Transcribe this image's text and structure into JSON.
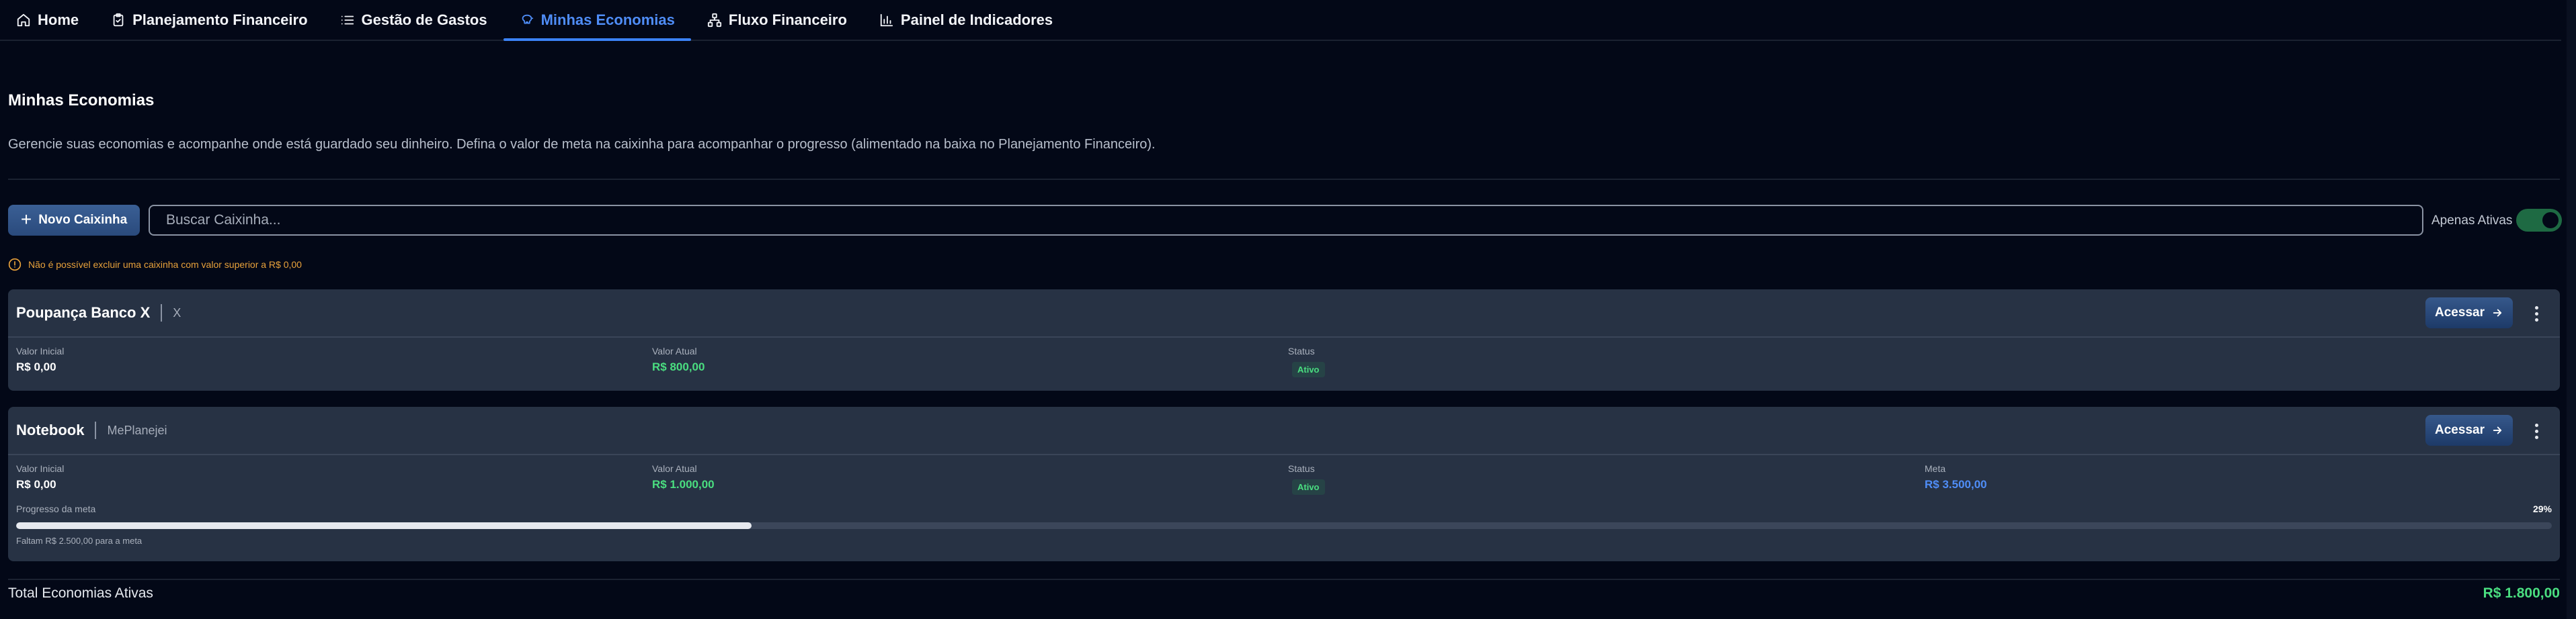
{
  "nav": {
    "tabs": [
      {
        "label": "Home",
        "icon": "home-icon",
        "active": false
      },
      {
        "label": "Planejamento Financeiro",
        "icon": "clipboard-icon",
        "active": false
      },
      {
        "label": "Gestão de Gastos",
        "icon": "list-icon",
        "active": false
      },
      {
        "label": "Minhas Economias",
        "icon": "piggy-bank-icon",
        "active": true
      },
      {
        "label": "Fluxo Financeiro",
        "icon": "workflow-icon",
        "active": false
      },
      {
        "label": "Painel de Indicadores",
        "icon": "bar-chart-icon",
        "active": false
      }
    ]
  },
  "header": {
    "title": "Minhas Economias",
    "description": "Gerencie suas economias e acompanhe onde está guardado seu dinheiro. Defina o valor de meta na caixinha para acompanhar o progresso (alimentado na baixa no Planejamento Financeiro)."
  },
  "toolbar": {
    "new_button": "Novo Caixinha",
    "search_placeholder": "Buscar Caixinha...",
    "search_value": "",
    "toggle_label": "Apenas Ativas",
    "toggle_on": true
  },
  "warning": "Não é possível excluir uma caixinha com valor superior a R$ 0,00",
  "labels": {
    "initial": "Valor Inicial",
    "current": "Valor Atual",
    "status": "Status",
    "goal": "Meta",
    "access": "Acessar",
    "progress": "Progresso da meta"
  },
  "boxes": [
    {
      "name": "Poupança Banco X",
      "bank": "X",
      "initial": "R$ 0,00",
      "current": "R$ 800,00",
      "status": "Ativo"
    },
    {
      "name": "Notebook",
      "bank": "MePlanejei",
      "initial": "R$ 0,00",
      "current": "R$ 1.000,00",
      "status": "Ativo",
      "goal": "R$ 3.500,00",
      "progress_pct": "29%",
      "progress_fraction": 0.29,
      "remaining": "Faltam R$ 2.500,00 para a meta"
    }
  ],
  "footer": {
    "total_label": "Total Economias Ativas",
    "total_value": "R$ 1.800,00"
  },
  "colors": {
    "accent": "#3b82f6",
    "positive": "#4ade80",
    "warning": "#e9a23b",
    "card": "#273244",
    "background": "#030817"
  }
}
